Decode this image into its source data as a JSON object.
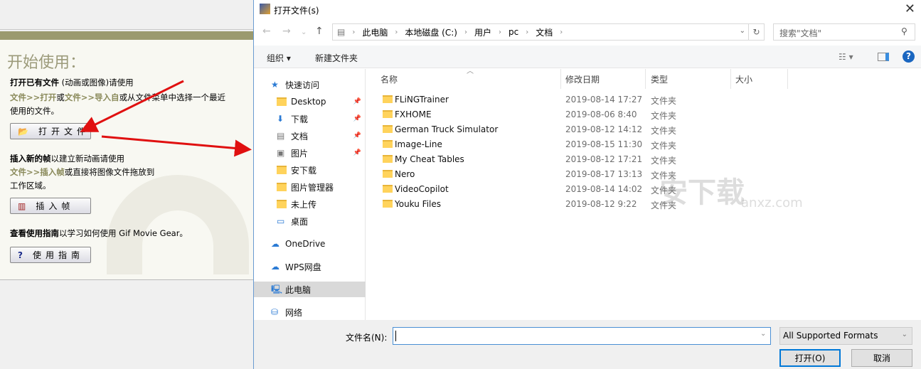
{
  "app": {
    "heading": "开始使用：",
    "open_text_bold": "打开已有文件",
    "open_text": " (动画或图像)请使用",
    "open_path1": "文件>>打开",
    "open_or": "或",
    "open_path2": "文件>>导入自",
    "open_rest": "或从文件菜单中选择一个最近",
    "open_rest2": "使用的文件。",
    "open_button": "打开文件",
    "insert_bold": "插入新的帧",
    "insert_text": "以建立新动画请使用",
    "insert_path": "文件>>插入帧",
    "insert_rest": "或直接将图像文件拖放到",
    "insert_rest2": "工作区域。",
    "insert_button": "插入帧",
    "guide_bold": "查看使用指南",
    "guide_text": "以学习如何使用 Gif Movie Gear。",
    "guide_button": "使用指南"
  },
  "dialog": {
    "title": "打开文件(s)",
    "close": "✕",
    "breadcrumb": [
      "此电脑",
      "本地磁盘 (C:)",
      "用户",
      "pc",
      "文档"
    ],
    "search_placeholder": "搜索\"文档\"",
    "toolbar": {
      "organize": "组织 ▾",
      "new_folder": "新建文件夹"
    },
    "nav": [
      {
        "label": "快速访问",
        "icon": "star"
      },
      {
        "label": "Desktop",
        "icon": "folder",
        "pinned": true
      },
      {
        "label": "下载",
        "icon": "download",
        "pinned": true
      },
      {
        "label": "文档",
        "icon": "document",
        "pinned": true
      },
      {
        "label": "图片",
        "icon": "picture",
        "pinned": true
      },
      {
        "label": "安下载",
        "icon": "folder"
      },
      {
        "label": "图片管理器",
        "icon": "folder"
      },
      {
        "label": "未上传",
        "icon": "folder"
      },
      {
        "label": "桌面",
        "icon": "desktop"
      },
      {
        "label": "OneDrive",
        "icon": "cloud"
      },
      {
        "label": "WPS网盘",
        "icon": "cloud"
      },
      {
        "label": "此电脑",
        "icon": "computer",
        "selected": true
      },
      {
        "label": "网络",
        "icon": "network"
      }
    ],
    "columns": [
      "名称",
      "修改日期",
      "类型",
      "大小"
    ],
    "files": [
      {
        "name": "FLiNGTrainer",
        "date": "2019-08-14 17:27",
        "type": "文件夹"
      },
      {
        "name": "FXHOME",
        "date": "2019-08-06 8:40",
        "type": "文件夹"
      },
      {
        "name": "German Truck Simulator",
        "date": "2019-08-12 14:12",
        "type": "文件夹"
      },
      {
        "name": "Image-Line",
        "date": "2019-08-15 11:30",
        "type": "文件夹"
      },
      {
        "name": "My Cheat Tables",
        "date": "2019-08-12 17:21",
        "type": "文件夹"
      },
      {
        "name": "Nero",
        "date": "2019-08-17 13:13",
        "type": "文件夹"
      },
      {
        "name": "VideoCopilot",
        "date": "2019-08-14 14:02",
        "type": "文件夹"
      },
      {
        "name": "Youku Files",
        "date": "2019-08-12 9:22",
        "type": "文件夹"
      }
    ],
    "filename_label": "文件名(N):",
    "filename_value": "",
    "filter": "All Supported Formats",
    "open": "打开(O)",
    "cancel": "取消"
  },
  "watermark": {
    "text": "安下载",
    "domain": "anxz.com"
  },
  "colors": {
    "olive": "#9b9a6e",
    "accent": "#0078d7",
    "arrow": "#e01010"
  }
}
